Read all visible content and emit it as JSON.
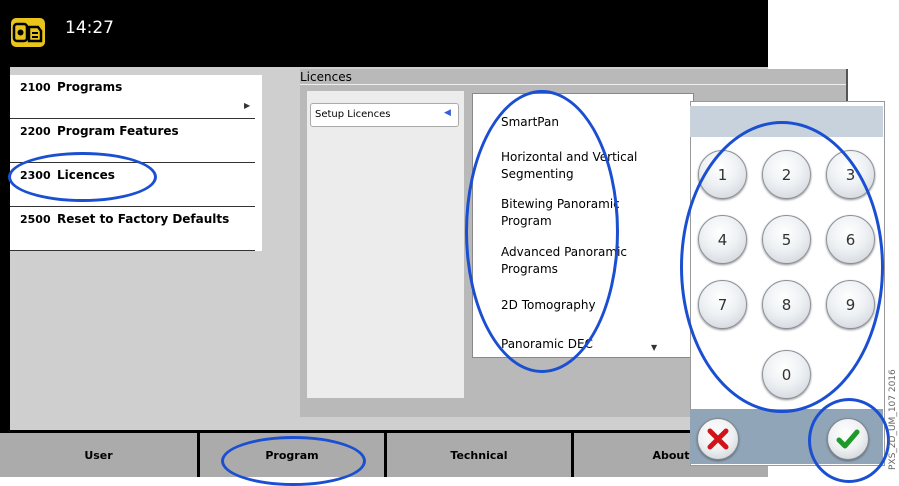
{
  "header": {
    "time": "14:27"
  },
  "menu": {
    "items": [
      {
        "code": "2100",
        "label": "Programs",
        "has_arrow": true
      },
      {
        "code": "2200",
        "label": "Program Features",
        "has_arrow": false
      },
      {
        "code": "2300",
        "label": "Licences",
        "has_arrow": false
      },
      {
        "code": "2500",
        "label": "Reset to Factory Defaults",
        "has_arrow": false
      }
    ]
  },
  "licences": {
    "title": "Licences",
    "setup_label": "Setup Licences",
    "items": [
      "SmartPan",
      "Horizontal and Vertical Segmenting",
      "Bitewing Panoramic Program",
      "Advanced Panoramic Programs",
      "2D Tomography",
      "Panoramic DEC"
    ]
  },
  "keypad": {
    "keys": [
      "1",
      "2",
      "3",
      "4",
      "5",
      "6",
      "7",
      "8",
      "9",
      "0"
    ],
    "cancel_icon": "cross-icon",
    "confirm_icon": "check-icon"
  },
  "nav": {
    "tabs": [
      "User",
      "Program",
      "Technical",
      "About"
    ]
  },
  "side_code": "PXS_2D_UM_107 2016",
  "colors": {
    "highlight_ring": "#1a4fd1",
    "logo_bg": "#e9c51c",
    "keypad_header": "#c7d2dc",
    "keypad_footer": "#91a5b8"
  }
}
